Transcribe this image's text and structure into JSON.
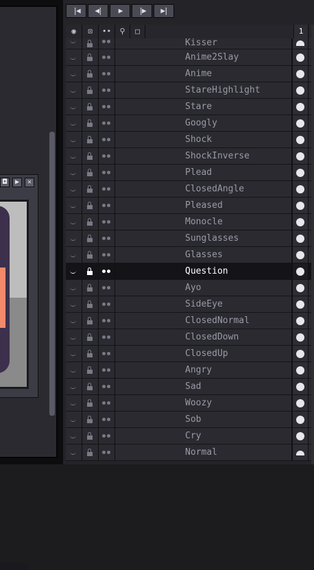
{
  "playback": {
    "first_frame": "|◀",
    "prev_frame": "◀|",
    "play": "▶",
    "next_frame": "|▶",
    "last_frame": "▶|"
  },
  "preview_window": {
    "btn_a": "◘",
    "btn_b": "▶",
    "btn_close": "✕"
  },
  "timeline": {
    "header_eye": "◉",
    "header_lock": "⊡",
    "header_cont": "••",
    "header_tree": "⚲",
    "header_box": "□",
    "frame_number": "1",
    "layers": [
      {
        "name": "Kisser",
        "active": false
      },
      {
        "name": "Anime2Slay",
        "active": false
      },
      {
        "name": "Anime",
        "active": false
      },
      {
        "name": "StareHighlight",
        "active": false
      },
      {
        "name": "Stare",
        "active": false
      },
      {
        "name": "Googly",
        "active": false
      },
      {
        "name": "Shock",
        "active": false
      },
      {
        "name": "ShockInverse",
        "active": false
      },
      {
        "name": "Plead",
        "active": false
      },
      {
        "name": "ClosedAngle",
        "active": false
      },
      {
        "name": "Pleased",
        "active": false
      },
      {
        "name": "Monocle",
        "active": false
      },
      {
        "name": "Sunglasses",
        "active": false
      },
      {
        "name": "Glasses",
        "active": false
      },
      {
        "name": "Question",
        "active": true
      },
      {
        "name": "Ayo",
        "active": false
      },
      {
        "name": "SideEye",
        "active": false
      },
      {
        "name": "ClosedNormal",
        "active": false
      },
      {
        "name": "ClosedDown",
        "active": false
      },
      {
        "name": "ClosedUp",
        "active": false
      },
      {
        "name": "Angry",
        "active": false
      },
      {
        "name": "Sad",
        "active": false
      },
      {
        "name": "Woozy",
        "active": false
      },
      {
        "name": "Sob",
        "active": false
      },
      {
        "name": "Cry",
        "active": false
      },
      {
        "name": "Normal",
        "active": false
      }
    ]
  },
  "colors": {
    "active_row": "#141418",
    "row": "#2a2a30",
    "accent_skin": "#f38a6c",
    "accent_body": "#3c304c"
  }
}
